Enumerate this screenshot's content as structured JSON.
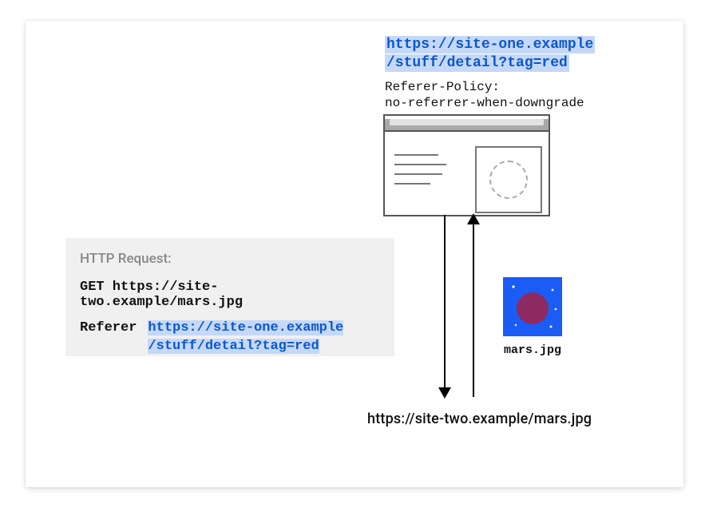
{
  "diagram": {
    "origin_url_line1": "https://site-one.example",
    "origin_url_line2": "/stuff/detail?tag=red",
    "referer_policy_label": "Referer-Policy:",
    "referer_policy_value": "no-referrer-when-downgrade",
    "http_request_title": "HTTP Request:",
    "http_get_line": "GET https://site-two.example/mars.jpg",
    "http_referer_label": "Referer",
    "http_referer_value_line1": "https://site-one.example",
    "http_referer_value_line2": "/stuff/detail?tag=red",
    "mars_label": "mars.jpg",
    "target_url": "https://site-two.example/mars.jpg",
    "colors": {
      "highlight_bg": "#c5d8f7",
      "highlight_fg": "#0b57d0",
      "mars_bg": "#1b5cf5",
      "mars_planet": "#8e2a62"
    }
  }
}
